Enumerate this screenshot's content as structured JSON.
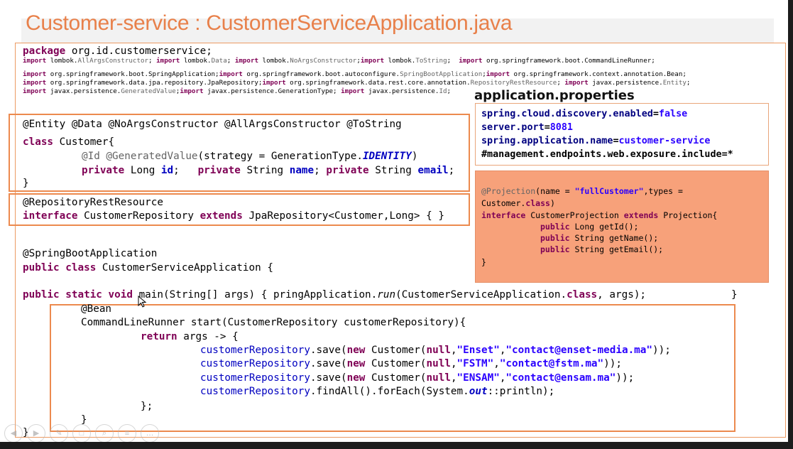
{
  "slide": {
    "title": "Customer-service : CustomerServiceApplication.java"
  },
  "imports": {
    "package_kw": "package",
    "package_name": " org.id.customerservice;",
    "lines": [
      [
        [
          "k",
          "import"
        ],
        [
          "t",
          " lombok."
        ],
        [
          "a",
          "AllArgsConstructor"
        ],
        [
          "t",
          "; "
        ],
        [
          "k",
          "import"
        ],
        [
          "t",
          " lombok."
        ],
        [
          "a",
          "Data"
        ],
        [
          "t",
          "; "
        ],
        [
          "k",
          "import"
        ],
        [
          "t",
          " lombok."
        ],
        [
          "a",
          "NoArgsConstructor"
        ],
        [
          "t",
          ";"
        ],
        [
          "k",
          "import"
        ],
        [
          "t",
          " lombok."
        ],
        [
          "a",
          "ToString"
        ],
        [
          "t",
          ";  "
        ],
        [
          "k",
          "import"
        ],
        [
          "t",
          " org.springframework.boot.CommandLineRunner;"
        ]
      ],
      [
        [
          "k",
          "import"
        ],
        [
          "t",
          " org.springframework.boot.SpringApplication;"
        ],
        [
          "k",
          "import"
        ],
        [
          "t",
          " org.springframework.boot.autoconfigure."
        ],
        [
          "a",
          "SpringBootApplication"
        ],
        [
          "t",
          ";"
        ],
        [
          "k",
          "import"
        ],
        [
          "t",
          " org.springframework.context.annotation.Bean;"
        ]
      ],
      [
        [
          "k",
          "import"
        ],
        [
          "t",
          " org.springframework.data.jpa.repository.JpaRepository;"
        ],
        [
          "k",
          "import"
        ],
        [
          "t",
          " org.springframework.data.rest.core.annotation."
        ],
        [
          "a",
          "RepositoryRestResource"
        ],
        [
          "t",
          "; "
        ],
        [
          "k",
          "import"
        ],
        [
          "t",
          " javax.persistence."
        ],
        [
          "a",
          "Entity"
        ],
        [
          "t",
          ";"
        ]
      ],
      [
        [
          "k",
          "import"
        ],
        [
          "t",
          " javax.persistence."
        ],
        [
          "a",
          "GeneratedValue"
        ],
        [
          "t",
          ";"
        ],
        [
          "k",
          "import"
        ],
        [
          "t",
          " javax.persistence.GenerationType; "
        ],
        [
          "k",
          "import"
        ],
        [
          "t",
          " javax.persistence."
        ],
        [
          "a",
          "Id"
        ],
        [
          "t",
          ";"
        ]
      ]
    ]
  },
  "entity": {
    "annotations": "@Entity @Data @NoArgsConstructor @AllArgsConstructor @ToString",
    "class_kw": "class",
    "class_name": " Customer{",
    "id_annotations": "@Id @GeneratedValue",
    "strategy_text": "(strategy = GenerationType.",
    "identity": "IDENTITY",
    "strategy_end": ")",
    "private_kw": "private",
    "long_type": " Long ",
    "field_id": "id",
    "sep1": ";   ",
    "string_type": " String ",
    "field_name": "name",
    "sep2": "; ",
    "field_email": "email",
    "sep3": ";",
    "close": "}"
  },
  "repository": {
    "annotation": "@RepositoryRestResource",
    "interface_kw": "interface",
    "name": " CustomerRepository ",
    "extends_kw": "extends",
    "rest": " JpaRepository<Customer,Long> { }"
  },
  "app": {
    "annotation": "@SpringBootApplication",
    "public_kw": "public",
    "class_kw": "class",
    "class_rest": " CustomerServiceApplication {",
    "static_kw": "static",
    "void_kw": "void",
    "main_sig": " main(String[] args) { pringApplication.",
    "run": "run",
    "main_args": "(CustomerServiceApplication.",
    "main_end": ", args);",
    "main_close": "}",
    "bean": "@Bean",
    "runner_sig": "CommandLineRunner start(CustomerRepository customerRepository){",
    "return_kw": "return",
    "lambda": " args -> {",
    "repo_var": "customerRepository",
    "save_call": ".save(",
    "new_kw": "new",
    "customer_ctor": " Customer(",
    "null_kw": "null",
    "saves": [
      {
        "name": "\"Enset\"",
        "email": "\"contact@enset-media.ma\""
      },
      {
        "name": "\"FSTM\"",
        "email": "\"contact@fstm.ma\""
      },
      {
        "name": "\"ENSAM\"",
        "email": "\"contact@ensam.ma\""
      }
    ],
    "findall_call": ".findAll().forEach(System.",
    "out": "out",
    "println": "::println);",
    "lambda_close": "};",
    "runner_close": "}",
    "class_close": "}"
  },
  "properties": {
    "title": "application.properties",
    "lines": [
      {
        "key": "spring.cloud.discovery.enabled",
        "value": "false"
      },
      {
        "key": "server.port",
        "value": "8081"
      },
      {
        "key": "spring.application.name",
        "value": "customer-service"
      }
    ],
    "comment": "#management.endpoints.web.exposure.include=*"
  },
  "projection": {
    "annotation": "@Projection",
    "args1": "(name = ",
    "name_value": "\"fullCustomer\"",
    "args2": ",types =",
    "line2": "Customer.",
    "class_kw": "class",
    "line2_end": ")",
    "interface_kw": "interface",
    "iface_name": " CustomerProjection ",
    "extends_kw": "extends",
    "iface_rest": " Projection{",
    "methods": [
      {
        "type": " Long ",
        "name": "getId();"
      },
      {
        "type": " String ",
        "name": "getName();"
      },
      {
        "type": " String ",
        "name": "getEmail();"
      }
    ],
    "public_kw": "public",
    "close": "}"
  },
  "player_controls": {
    "icons": [
      "prev-icon",
      "play-icon",
      "pen-icon",
      "slides-icon",
      "zoom-icon",
      "menu-icon",
      "more-icon"
    ]
  },
  "colors": {
    "title": "#e8804a",
    "keyword": "#7f0055",
    "annotation": "#646464",
    "string": "#2a00ff",
    "field": "#0000c0",
    "box_border": "#ec8a4e",
    "projection_fill": "#f7a17a"
  }
}
